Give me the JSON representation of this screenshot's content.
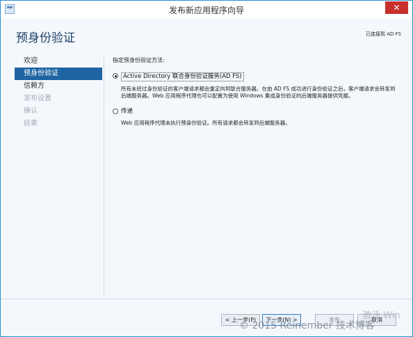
{
  "window": {
    "title": "发布新应用程序向导",
    "close_label": "✕"
  },
  "header": {
    "page_title": "预身份验证",
    "connected_text": "已连接到 AD FS"
  },
  "nav": {
    "items": [
      {
        "label": "欢迎",
        "state": "normal"
      },
      {
        "label": "预身份验证",
        "state": "active"
      },
      {
        "label": "信赖方",
        "state": "normal"
      },
      {
        "label": "发布设置",
        "state": "disabled"
      },
      {
        "label": "确认",
        "state": "disabled"
      },
      {
        "label": "结果",
        "state": "disabled"
      }
    ]
  },
  "content": {
    "method_label": "指定预身份验证方法:",
    "options": [
      {
        "label": "Active Directory 联合身份验证服务(AD FS)",
        "checked": true,
        "description": "所有未经过身份验证的客户端请求都会重定向到联合服务器。在由 AD FS 成功进行身份验证之后，客户端请求会转发到后端服务器。Web 应用程序代理也可以配置为使用 Windows 集成身份验证的后端服务器提供凭据。"
      },
      {
        "label": "传递",
        "checked": false,
        "description": "Web 应用程序代理未执行预身份验证。所有请求都会转发到后端服务器。"
      }
    ]
  },
  "footer": {
    "prev_label": "< 上一步(P)",
    "next_label": "下一步(N) >",
    "publish_label": "发布",
    "cancel_label": "取消"
  },
  "overlay": {
    "watermark": "© 2015 Reinember 技术博客",
    "activate_text": "激活 Win"
  }
}
